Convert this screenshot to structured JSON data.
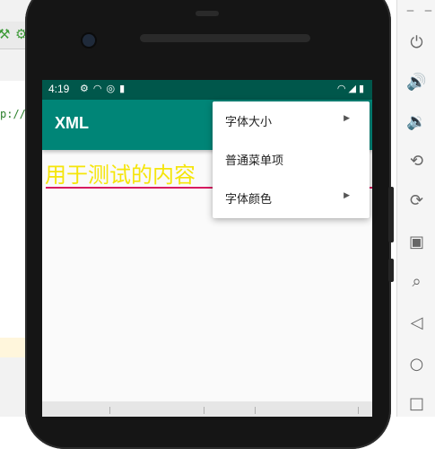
{
  "ide": {
    "code_snippet": "p://"
  },
  "phone": {
    "status_bar": {
      "time": "4:19",
      "left_icons": [
        "gear-icon",
        "wifi-icon",
        "sync-icon",
        "sd-card-icon"
      ],
      "right_icons": [
        "wifi-icon",
        "signal-icon",
        "battery-icon"
      ]
    },
    "app_bar": {
      "title": "XML",
      "background": "#008577"
    },
    "content": {
      "text": "用于测试的内容",
      "text_color": "#f5e50a",
      "underline_color": "#d81b60"
    },
    "menu": {
      "items": [
        {
          "label": "字体大小",
          "has_submenu": true
        },
        {
          "label": "普通菜单项",
          "has_submenu": false
        },
        {
          "label": "字体颜色",
          "has_submenu": true
        }
      ]
    }
  },
  "emulator_toolbar": {
    "buttons": [
      "power-icon",
      "volume-up-icon",
      "volume-down-icon",
      "rotate-left-icon",
      "rotate-right-icon",
      "camera-icon",
      "zoom-icon",
      "back-icon",
      "home-icon",
      "overview-icon"
    ]
  }
}
